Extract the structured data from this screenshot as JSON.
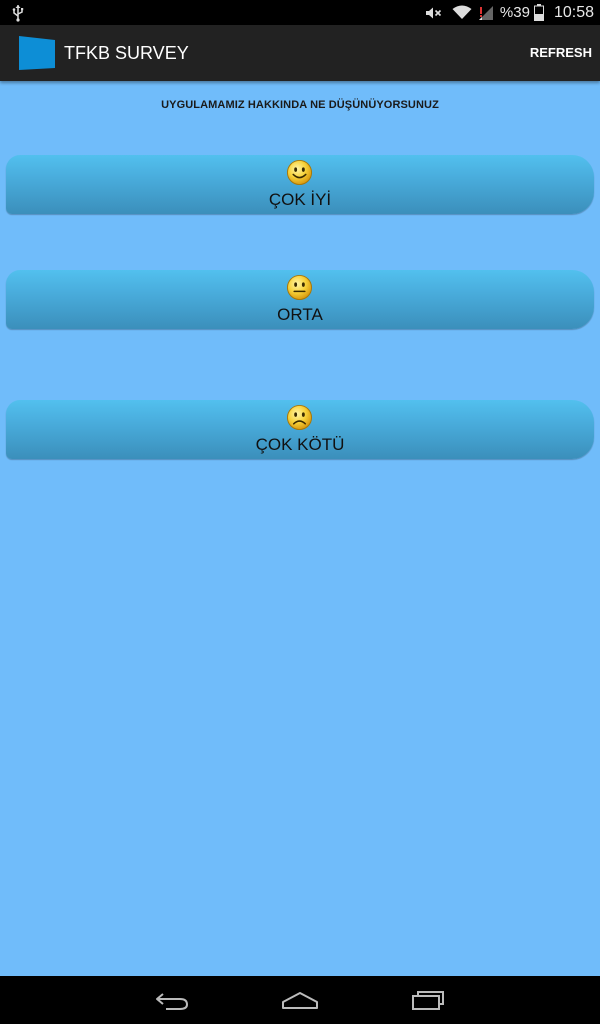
{
  "status_bar": {
    "battery_percent": "%39",
    "time": "10:58",
    "icons": [
      "usb-icon",
      "mute-icon",
      "wifi-icon",
      "signal-icon",
      "battery-icon"
    ]
  },
  "action_bar": {
    "title": "TFKB SURVEY",
    "refresh_label": "REFRESH",
    "logo_color": "#0d8ed6"
  },
  "survey": {
    "question": "UYGULAMAMIZ HAKKINDA NE DÜŞÜNÜYORSUNUZ",
    "answers": [
      {
        "label": "ÇOK İYİ",
        "icon": "happy-face-icon"
      },
      {
        "label": "ORTA",
        "icon": "neutral-face-icon"
      },
      {
        "label": "ÇOK KÖTÜ",
        "icon": "sad-face-icon"
      }
    ]
  },
  "colors": {
    "background": "#70bcfa",
    "button_top": "#52c0ee",
    "button_bottom": "#3b8fbb",
    "action_bar": "#222222"
  },
  "nav_bar": {
    "icons": [
      "back-icon",
      "home-icon",
      "recents-icon"
    ]
  }
}
